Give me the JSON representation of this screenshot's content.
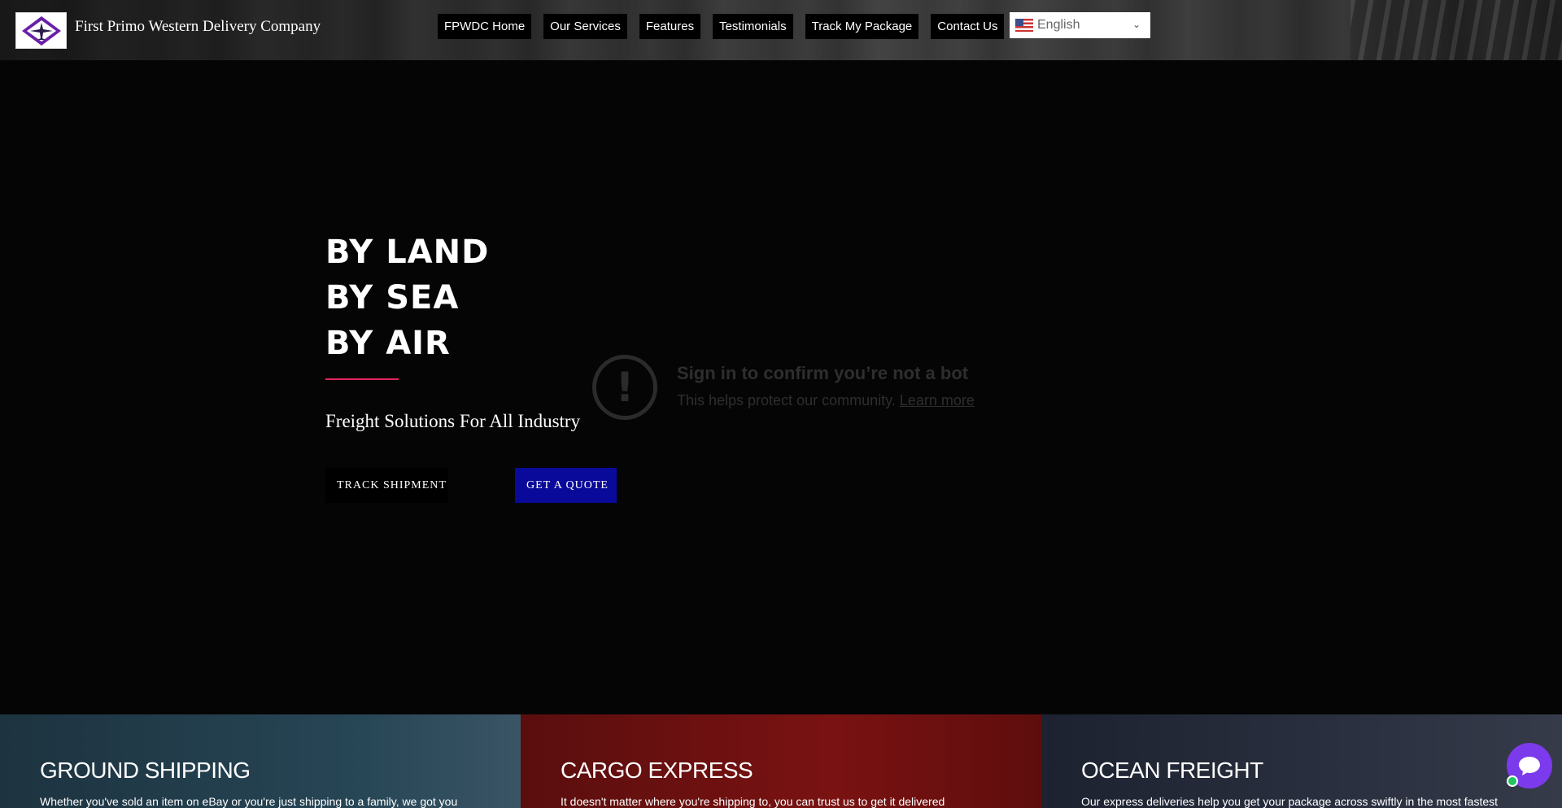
{
  "header": {
    "brand_name": "First Primo Western Delivery Company",
    "logo_icon": "airplane-logo-icon",
    "nav": [
      {
        "label": "FPWDC Home"
      },
      {
        "label": "Our Services"
      },
      {
        "label": "Features"
      },
      {
        "label": "Testimonials"
      },
      {
        "label": "Track My Package"
      },
      {
        "label": "Contact Us"
      }
    ],
    "language": {
      "selected": "English",
      "flag_icon": "us-flag-icon"
    }
  },
  "hero": {
    "lines": [
      "BY LAND",
      "BY SEA",
      "BY AIR"
    ],
    "subtitle": "Freight Solutions For All Industry",
    "track_button": "TRACK SHIPMENT",
    "quote_button": "GET A QUOTE",
    "accent_color": "#e0245e",
    "quote_color": "#0a0a9a"
  },
  "bot_notice": {
    "title": "Sign in to confirm you’re not a bot",
    "text": "This helps protect our community.",
    "link": "Learn more",
    "icon": "alert-circle-icon"
  },
  "services": [
    {
      "title": "GROUND SHIPPING",
      "text": "Whether you've sold an item on eBay or you're just shipping to a family, we got you"
    },
    {
      "title": "CARGO EXPRESS",
      "text": "It doesn't matter where you're shipping to, you can trust us to get it delivered"
    },
    {
      "title": "OCEAN FREIGHT",
      "text": "Our express deliveries help you get your package across swiftly in the most fastest"
    }
  ],
  "chat": {
    "icon": "chat-bubble-icon",
    "color": "#7c3aed"
  }
}
